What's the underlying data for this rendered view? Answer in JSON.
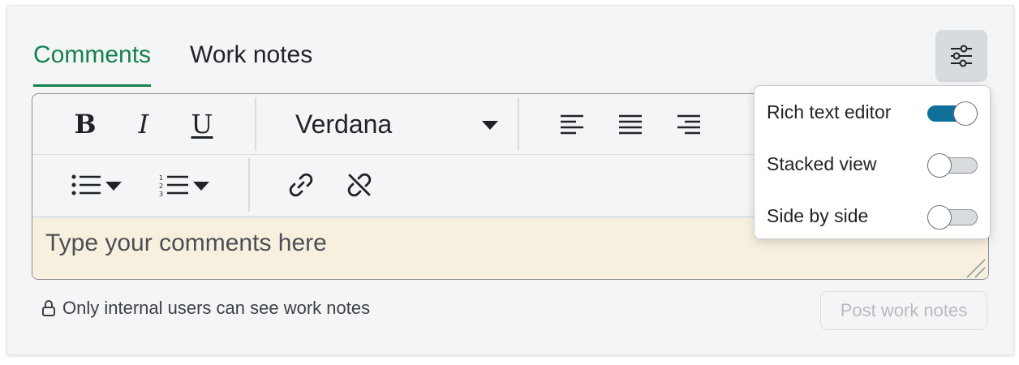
{
  "tabs": [
    {
      "label": "Comments",
      "active": true
    },
    {
      "label": "Work notes",
      "active": false
    }
  ],
  "toolbar": {
    "bold_label": "B",
    "italic_label": "I",
    "underline_label": "U",
    "font_family_value": "Verdana"
  },
  "editor": {
    "placeholder": "Type your comments here",
    "background_color": "#f8f0df"
  },
  "notice": {
    "text": "Only internal users can see work notes"
  },
  "post_button": {
    "label": "Post work notes",
    "disabled": true
  },
  "view_options": [
    {
      "label": "Rich text editor",
      "enabled": true
    },
    {
      "label": "Stacked view",
      "enabled": false
    },
    {
      "label": "Side by side",
      "enabled": false
    }
  ],
  "colors": {
    "accent_green": "#17814e",
    "toggle_on": "#0f7199"
  },
  "icons": {
    "settings": "sliders-icon",
    "align_left": "align-left-icon",
    "align_center": "align-center-icon",
    "align_right": "align-right-icon",
    "bulleted_list": "bulleted-list-icon",
    "numbered_list": "numbered-list-icon",
    "link": "link-icon",
    "unlink": "unlink-icon",
    "lock": "lock-icon"
  }
}
